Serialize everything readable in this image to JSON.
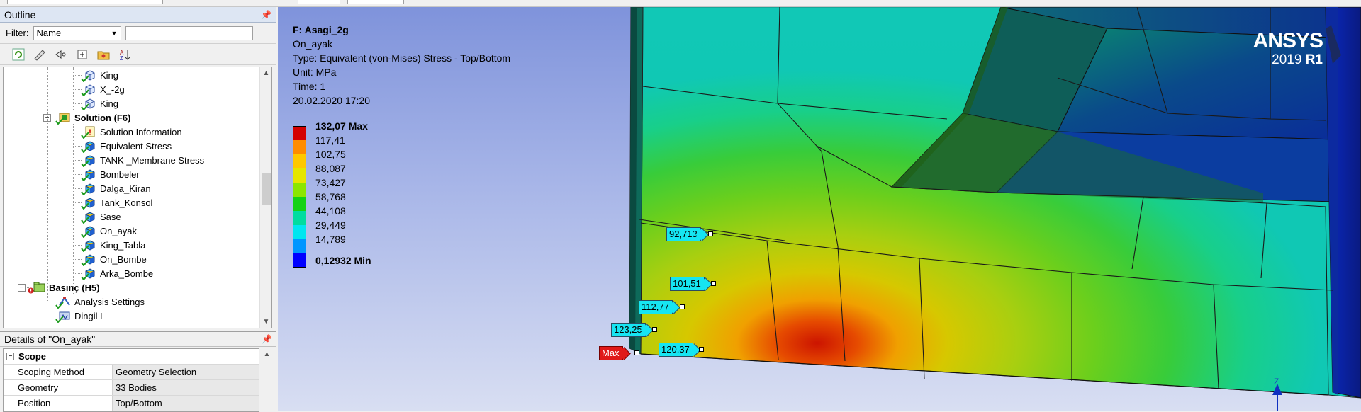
{
  "outline": {
    "title": "Outline",
    "pin": "❤",
    "filter_label": "Filter:",
    "filter_value": "Name",
    "tree": [
      {
        "label": "King",
        "level": 4,
        "bold": false,
        "icon": "geometry-icon"
      },
      {
        "label": "X_-2g",
        "level": 4,
        "bold": false,
        "icon": "geometry-icon"
      },
      {
        "label": "King",
        "level": 4,
        "bold": false,
        "icon": "geometry-icon"
      },
      {
        "label": "Solution (F6)",
        "level": 3,
        "bold": true,
        "icon": "solution-icon"
      },
      {
        "label": "Solution Information",
        "level": 4,
        "bold": false,
        "icon": "solution-info-icon"
      },
      {
        "label": "Equivalent Stress",
        "level": 4,
        "bold": false,
        "icon": "result-icon"
      },
      {
        "label": "TANK _Membrane Stress",
        "level": 4,
        "bold": false,
        "icon": "result-icon"
      },
      {
        "label": "Bombeler",
        "level": 4,
        "bold": false,
        "icon": "result-icon"
      },
      {
        "label": "Dalga_Kiran",
        "level": 4,
        "bold": false,
        "icon": "result-icon"
      },
      {
        "label": "Tank_Konsol",
        "level": 4,
        "bold": false,
        "icon": "result-icon"
      },
      {
        "label": "Sase",
        "level": 4,
        "bold": false,
        "icon": "result-icon"
      },
      {
        "label": "On_ayak",
        "level": 4,
        "bold": false,
        "icon": "result-icon"
      },
      {
        "label": "King_Tabla",
        "level": 4,
        "bold": false,
        "icon": "result-icon"
      },
      {
        "label": "On_Bombe",
        "level": 4,
        "bold": false,
        "icon": "result-icon"
      },
      {
        "label": "Arka_Bombe",
        "level": 4,
        "bold": false,
        "icon": "result-icon"
      },
      {
        "label": "Basınç (H5)",
        "level": 2,
        "bold": true,
        "icon": "static-structural-icon"
      },
      {
        "label": "Analysis Settings",
        "level": 3,
        "bold": false,
        "icon": "analysis-settings-icon"
      },
      {
        "label": "Dingil L",
        "level": 3,
        "bold": false,
        "icon": "support-icon"
      }
    ]
  },
  "details": {
    "title": "Details of \"On_ayak\"",
    "section": "Scope",
    "rows": [
      {
        "key": "Scoping Method",
        "value": "Geometry Selection"
      },
      {
        "key": "Geometry",
        "value": "33 Bodies"
      },
      {
        "key": "Position",
        "value": "Top/Bottom"
      }
    ]
  },
  "viewport": {
    "info": {
      "title": "F: Asagi_2g",
      "name": "On_ayak",
      "type": "Type: Equivalent (von-Mises) Stress - Top/Bottom",
      "unit": "Unit: MPa",
      "time": "Time: 1",
      "date": "20.02.2020 17:20"
    },
    "legend": [
      {
        "label": "132,07 Max",
        "color": "#d40000",
        "bold": true
      },
      {
        "label": "117,41",
        "color": "#ff8c00",
        "bold": false
      },
      {
        "label": "102,75",
        "color": "#ffc800",
        "bold": false
      },
      {
        "label": "88,087",
        "color": "#e6e600",
        "bold": false
      },
      {
        "label": "73,427",
        "color": "#8ce600",
        "bold": false
      },
      {
        "label": "58,768",
        "color": "#14d214",
        "bold": false
      },
      {
        "label": "44,108",
        "color": "#00dca0",
        "bold": false
      },
      {
        "label": "29,449",
        "color": "#00e6f0",
        "bold": false
      },
      {
        "label": "14,789",
        "color": "#0096ff",
        "bold": false
      },
      {
        "label": "0,12932 Min",
        "color": "#0000ff",
        "bold": true
      }
    ],
    "logo": {
      "brand": "ANSYS",
      "version": "2019",
      "release": "R1"
    },
    "probes": [
      {
        "label": "92,713",
        "kind": "probe"
      },
      {
        "label": "101,51",
        "kind": "probe"
      },
      {
        "label": "112,77",
        "kind": "probe"
      },
      {
        "label": "123,25",
        "kind": "probe"
      },
      {
        "label": "120,37",
        "kind": "probe"
      },
      {
        "label": "Max",
        "kind": "max"
      }
    ],
    "triad_axis": "Z"
  }
}
